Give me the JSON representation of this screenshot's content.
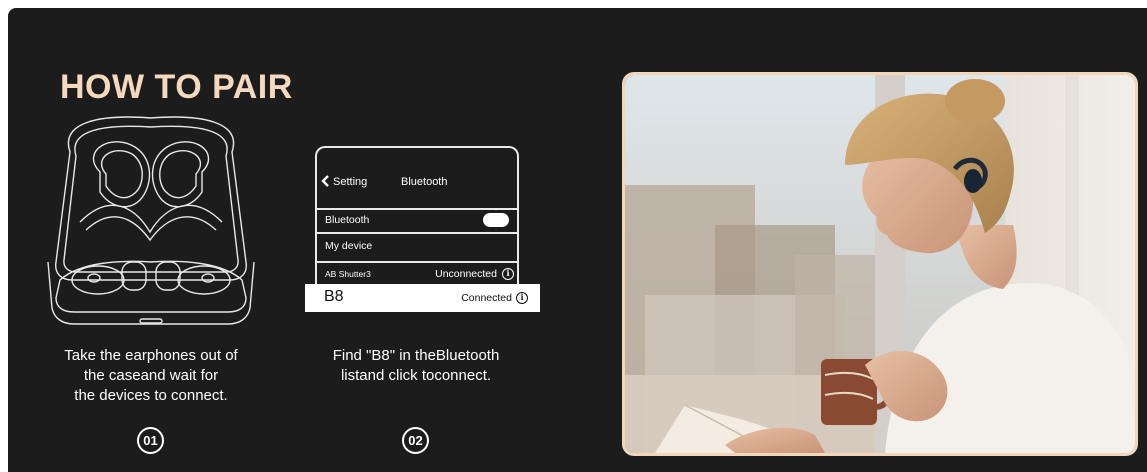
{
  "title": "HOW TO PAIR",
  "steps": [
    {
      "number": "01",
      "lines": [
        "Take the earphones out of",
        "the caseand wait for",
        "the devices to connect."
      ]
    },
    {
      "number": "02",
      "lines": [
        "Find \"B8\" in theBluetooth",
        "listand click toconnect."
      ]
    }
  ],
  "phone": {
    "back_label": "Setting",
    "header_title": "Bluetooth",
    "rows": [
      {
        "label": "Bluetooth",
        "toggle_on": true
      },
      {
        "label": "My device"
      },
      {
        "label": "AB Shutter3",
        "status": "Unconnected"
      },
      {
        "label": "B8",
        "status": "Connected",
        "highlighted": true
      }
    ]
  },
  "icons": {
    "back": "chevron-left-icon",
    "info": "info-circle-icon",
    "case": "earbuds-case-icon"
  },
  "colors": {
    "background": "#1c1c1c",
    "accent": "#f4d9bf",
    "photo_border": "#f1d6b9"
  }
}
